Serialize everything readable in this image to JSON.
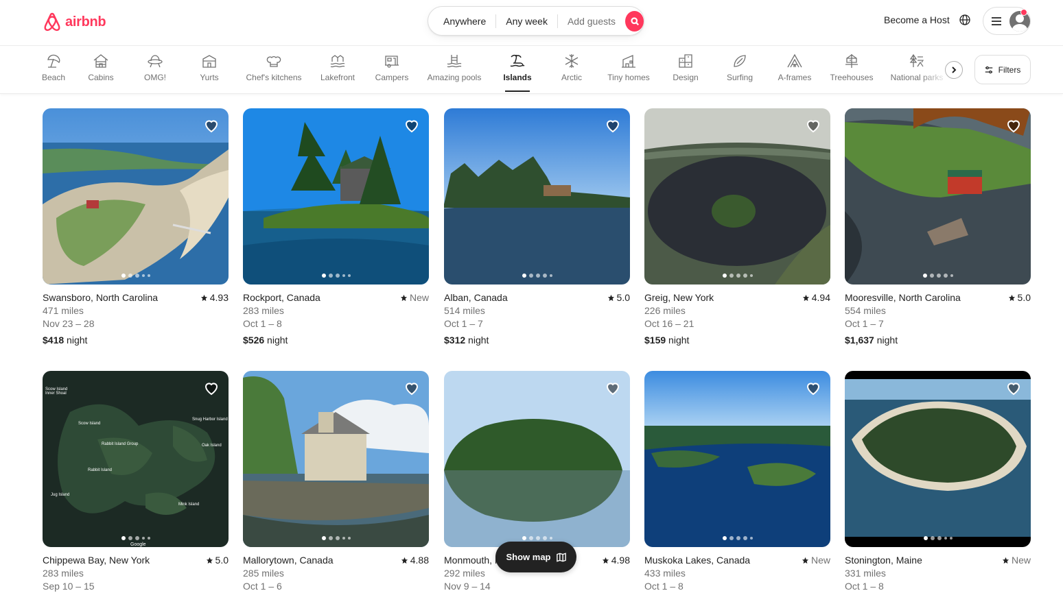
{
  "brand": {
    "name": "airbnb",
    "color": "#ff385c"
  },
  "search": {
    "anywhere": "Anywhere",
    "any_week": "Any week",
    "add_guests": "Add guests"
  },
  "header": {
    "become_host": "Become a Host"
  },
  "categories": [
    {
      "label": "Beach",
      "icon": "beach-umbrella-icon"
    },
    {
      "label": "Cabins",
      "icon": "cabin-icon"
    },
    {
      "label": "OMG!",
      "icon": "ufo-house-icon"
    },
    {
      "label": "Yurts",
      "icon": "yurt-icon"
    },
    {
      "label": "Chef's kitchens",
      "icon": "chef-hat-icon"
    },
    {
      "label": "Lakefront",
      "icon": "lakefront-icon"
    },
    {
      "label": "Campers",
      "icon": "camper-icon"
    },
    {
      "label": "Amazing pools",
      "icon": "pool-icon"
    },
    {
      "label": "Islands",
      "icon": "island-icon",
      "active": true
    },
    {
      "label": "Arctic",
      "icon": "snowflake-icon"
    },
    {
      "label": "Tiny homes",
      "icon": "tiny-home-icon"
    },
    {
      "label": "Design",
      "icon": "design-icon"
    },
    {
      "label": "Surfing",
      "icon": "surfboard-icon"
    },
    {
      "label": "A-frames",
      "icon": "a-frame-icon"
    },
    {
      "label": "Treehouses",
      "icon": "treehouse-icon"
    },
    {
      "label": "National parks",
      "icon": "national-park-icon"
    }
  ],
  "filters_label": "Filters",
  "listings": [
    {
      "location": "Swansboro, North Carolina",
      "rating": "4.93",
      "distance": "471 miles",
      "dates": "Nov 23 – 28",
      "price": "$418",
      "unit": "night"
    },
    {
      "location": "Rockport, Canada",
      "rating": "New",
      "distance": "283 miles",
      "dates": "Oct 1 – 8",
      "price": "$526",
      "unit": "night"
    },
    {
      "location": "Alban, Canada",
      "rating": "5.0",
      "distance": "514 miles",
      "dates": "Oct 1 – 7",
      "price": "$312",
      "unit": "night"
    },
    {
      "location": "Greig, New York",
      "rating": "4.94",
      "distance": "226 miles",
      "dates": "Oct 16 – 21",
      "price": "$159",
      "unit": "night"
    },
    {
      "location": "Mooresville, North Carolina",
      "rating": "5.0",
      "distance": "554 miles",
      "dates": "Oct 1 – 7",
      "price": "$1,637",
      "unit": "night"
    },
    {
      "location": "Chippewa Bay, New York",
      "rating": "5.0",
      "distance": "283 miles",
      "dates": "Sep 10 – 15",
      "price": "",
      "unit": ""
    },
    {
      "location": "Mallorytown, Canada",
      "rating": "4.88",
      "distance": "285 miles",
      "dates": "Oct 1 – 6",
      "price": "",
      "unit": ""
    },
    {
      "location": "Monmouth, Maine",
      "rating": "4.98",
      "distance": "292 miles",
      "dates": "Nov 9 – 14",
      "price": "",
      "unit": ""
    },
    {
      "location": "Muskoka Lakes, Canada",
      "rating": "New",
      "distance": "433 miles",
      "dates": "Oct 1 – 8",
      "price": "",
      "unit": ""
    },
    {
      "location": "Stonington, Maine",
      "rating": "New",
      "distance": "331 miles",
      "dates": "Oct 1 – 8",
      "price": "",
      "unit": ""
    }
  ],
  "map_labels": [
    "Scow Island",
    "Inner Shoal",
    "Scow Island",
    "Snug Harbor Island",
    "Rabbit Island Group",
    "Rabbit Island",
    "Oak Island",
    "Jug Island",
    "Mink Island",
    "Google"
  ],
  "show_map": "Show map"
}
